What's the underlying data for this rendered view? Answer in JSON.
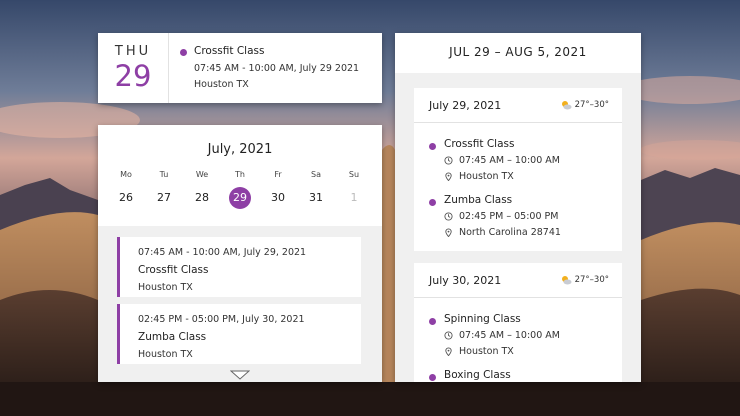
{
  "day_widget": {
    "weekday": "THU",
    "day": "29",
    "event": {
      "title": "Crossfit Class",
      "time": "07:45 AM - 10:00 AM, July 29 2021",
      "location": "Houston TX"
    }
  },
  "month_widget": {
    "title": "July, 2021",
    "week": [
      {
        "label": "Mo",
        "num": "26"
      },
      {
        "label": "Tu",
        "num": "27"
      },
      {
        "label": "We",
        "num": "28"
      },
      {
        "label": "Th",
        "num": "29"
      },
      {
        "label": "Fr",
        "num": "30"
      },
      {
        "label": "Sa",
        "num": "31"
      },
      {
        "label": "Su",
        "num": "1"
      }
    ],
    "events": [
      {
        "time": "07:45 AM - 10:00 AM, July 29, 2021",
        "title": "Crossfit Class",
        "location": "Houston TX"
      },
      {
        "time": "02:45 PM - 05:00 PM, July 30, 2021",
        "title": "Zumba Class",
        "location": "Houston TX"
      }
    ]
  },
  "agenda_widget": {
    "range": "JUL 29 – AUG 5, 2021",
    "days": [
      {
        "date": "July 29, 2021",
        "weather": "27°–30°",
        "events": [
          {
            "title": "Crossfit Class",
            "time": "07:45 AM – 10:00 AM",
            "location": "Houston TX"
          },
          {
            "title": "Zumba Class",
            "time": "02:45 PM – 05:00 PM",
            "location": "North Carolina 28741"
          }
        ]
      },
      {
        "date": "July 30, 2021",
        "weather": "27°–30°",
        "events": [
          {
            "title": "Spinning Class",
            "time": "07:45 AM – 10:00 AM",
            "location": "Houston TX"
          },
          {
            "title": "Boxing Class"
          }
        ]
      }
    ]
  },
  "colors": {
    "accent": "#8e3fa5"
  },
  "icons": {
    "time": "clock-icon",
    "location": "location-pin-icon",
    "weather": "partly-sunny-icon",
    "scroll": "chevron-down-icon"
  }
}
